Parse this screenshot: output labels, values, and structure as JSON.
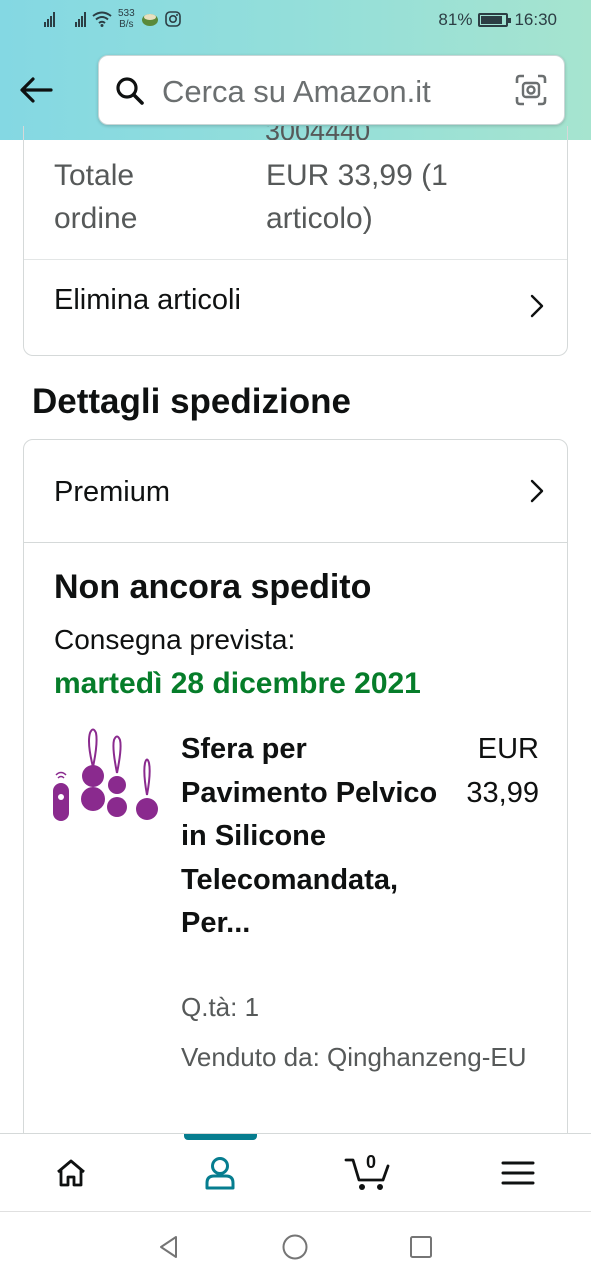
{
  "status_bar": {
    "net_speed_value": "533",
    "net_speed_unit": "B/s",
    "battery_percent": "81%",
    "battery_level": 0.81,
    "time": "16:30"
  },
  "header": {
    "search_placeholder": "Cerca su Amazon.it",
    "icons": [
      "back-arrow-icon",
      "search-icon",
      "camera-scan-icon"
    ]
  },
  "order_summary": {
    "clipped_text": "3004440",
    "total_label": "Totale ordine",
    "total_value": "EUR 33,99 (1 articolo)",
    "remove_items_label": "Elimina articoli"
  },
  "shipping": {
    "section_title": "Dettagli spedizione",
    "shipping_type": "Premium",
    "status": "Non ancora spedito",
    "delivery_label": "Consegna prevista:",
    "delivery_date": "martedì 28 dicembre 2021",
    "item": {
      "title": "Sfera per Pavimento Pelvico in Silicone Telecomandata, Per...",
      "price": "EUR 33,99",
      "quantity": "Q.tà: 1",
      "seller": "Venduto da: Qinghanzeng-EU",
      "product_color": "#8a2a8e"
    }
  },
  "bottom_nav": {
    "items": [
      "home-icon",
      "account-icon",
      "cart-icon",
      "menu-icon"
    ],
    "cart_count": "0",
    "active_index": 1,
    "accent_color": "#067d8f"
  },
  "system_nav": [
    "back-triangle-icon",
    "home-circle-icon",
    "recents-square-icon"
  ]
}
